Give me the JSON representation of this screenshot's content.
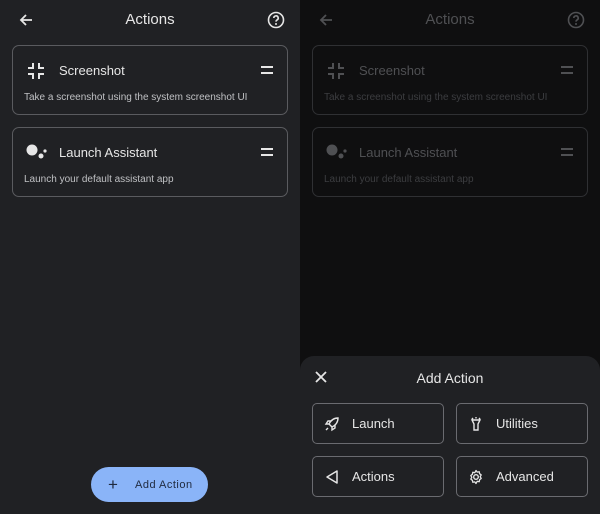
{
  "left": {
    "title": "Actions",
    "cards": [
      {
        "title": "Screenshot",
        "desc": "Take a screenshot using the system screenshot UI",
        "icon": "screenshot-icon"
      },
      {
        "title": "Launch Assistant",
        "desc": "Launch your default assistant app",
        "icon": "assistant-icon"
      }
    ],
    "fab": {
      "icon": "+",
      "label": "Add Action"
    }
  },
  "right": {
    "title": "Actions",
    "cards": [
      {
        "title": "Screenshot",
        "desc": "Take a screenshot using the system screenshot UI"
      },
      {
        "title": "Launch Assistant",
        "desc": "Launch your default assistant app"
      }
    ],
    "sheet": {
      "title": "Add Action",
      "options": [
        {
          "label": "Launch",
          "icon": "rocket-icon"
        },
        {
          "label": "Utilities",
          "icon": "flashlight-icon"
        },
        {
          "label": "Actions",
          "icon": "triangle-back-icon"
        },
        {
          "label": "Advanced",
          "icon": "gear-icon"
        }
      ]
    }
  },
  "colors": {
    "accent": "#8ab4f8",
    "surface": "#202124",
    "scrim": "#0f0f10"
  }
}
